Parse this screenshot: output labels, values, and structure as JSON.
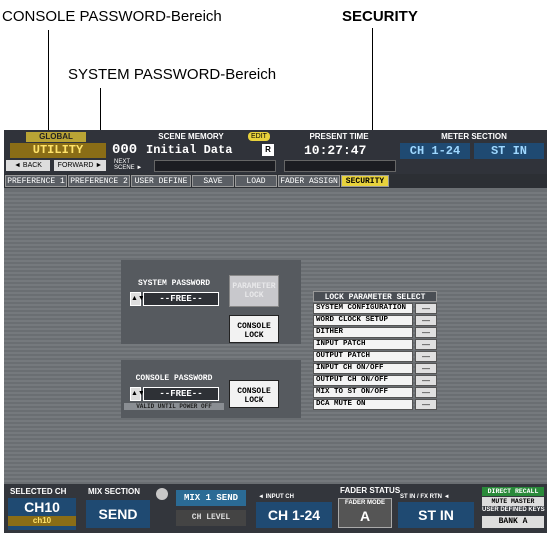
{
  "callouts": {
    "console_password_area": "CONSOLE PASSWORD-Bereich",
    "system_password_area": "SYSTEM PASSWORD-Bereich",
    "security": "SECURITY"
  },
  "top_bar": {
    "global_label": "GLOBAL",
    "utility_label": "UTILITY",
    "back_label": "◄ BACK",
    "forward_label": "FORWARD ►",
    "scene_memory_label": "SCENE MEMORY",
    "edit_badge": "EDIT",
    "scene_number": "000",
    "scene_name": "Initial Data",
    "scene_flag": "R",
    "next_scene_label": "NEXT SCENE ►",
    "present_time_label": "PRESENT TIME",
    "present_time": "10:27:47",
    "meter_section_label": "METER SECTION",
    "meter_ch": "CH 1-24",
    "meter_st": "ST IN"
  },
  "tabs": [
    {
      "label": "PREFERENCE 1"
    },
    {
      "label": "PREFERENCE 2"
    },
    {
      "label": "USER DEFINE"
    },
    {
      "label": "SAVE"
    },
    {
      "label": "LOAD"
    },
    {
      "label": "FADER ASSIGN"
    },
    {
      "label": "SECURITY",
      "active": true
    }
  ],
  "system_password": {
    "title": "SYSTEM PASSWORD",
    "value": "--FREE--",
    "parameter_lock_label": "PARAMETER LOCK",
    "console_lock_label": "CONSOLE LOCK"
  },
  "console_password": {
    "title": "CONSOLE PASSWORD",
    "value": "--FREE--",
    "note": "VALID UNTIL POWER OFF",
    "console_lock_label": "CONSOLE LOCK"
  },
  "lock_parameter_select": {
    "title": "LOCK PARAMETER SELECT",
    "items": [
      {
        "label": "SYSTEM CONFIGURATION",
        "state": "—"
      },
      {
        "label": "WORD CLOCK SETUP",
        "state": "—"
      },
      {
        "label": "DITHER",
        "state": "—"
      },
      {
        "label": "INPUT PATCH",
        "state": "—"
      },
      {
        "label": "OUTPUT PATCH",
        "state": "—"
      },
      {
        "label": "INPUT CH ON/OFF",
        "state": "—"
      },
      {
        "label": "OUTPUT CH ON/OFF",
        "state": "—"
      },
      {
        "label": "MIX TO ST ON/OFF",
        "state": "—"
      },
      {
        "label": "DCA MUTE ON",
        "state": "—"
      }
    ]
  },
  "bottom_bar": {
    "selected_ch_label": "SELECTED CH",
    "selected_ch": "CH10",
    "selected_ch_sub": "ch10",
    "mix_section_label": "MIX SECTION",
    "mix_section_value": "SEND",
    "mix_send": "MIX 1 SEND",
    "ch_level": "CH LEVEL",
    "fader_status_label": "FADER STATUS",
    "input_ch_label": "◄ INPUT CH",
    "input_ch": "CH 1-24",
    "fader_mode_label": "FADER MODE",
    "fader_mode": "A",
    "stin_label": "ST IN / FX RTN ◄",
    "stin_value": "ST IN",
    "direct_recall": "DIRECT RECALL",
    "mute_master": "MUTE MASTER",
    "user_defined_keys": "USER DEFINED KEYS",
    "bank": "BANK A"
  },
  "colors": {
    "accent_yellow": "#e8d23c",
    "display_blue": "#1f4a72",
    "screen_gray": "#6b6f73"
  }
}
